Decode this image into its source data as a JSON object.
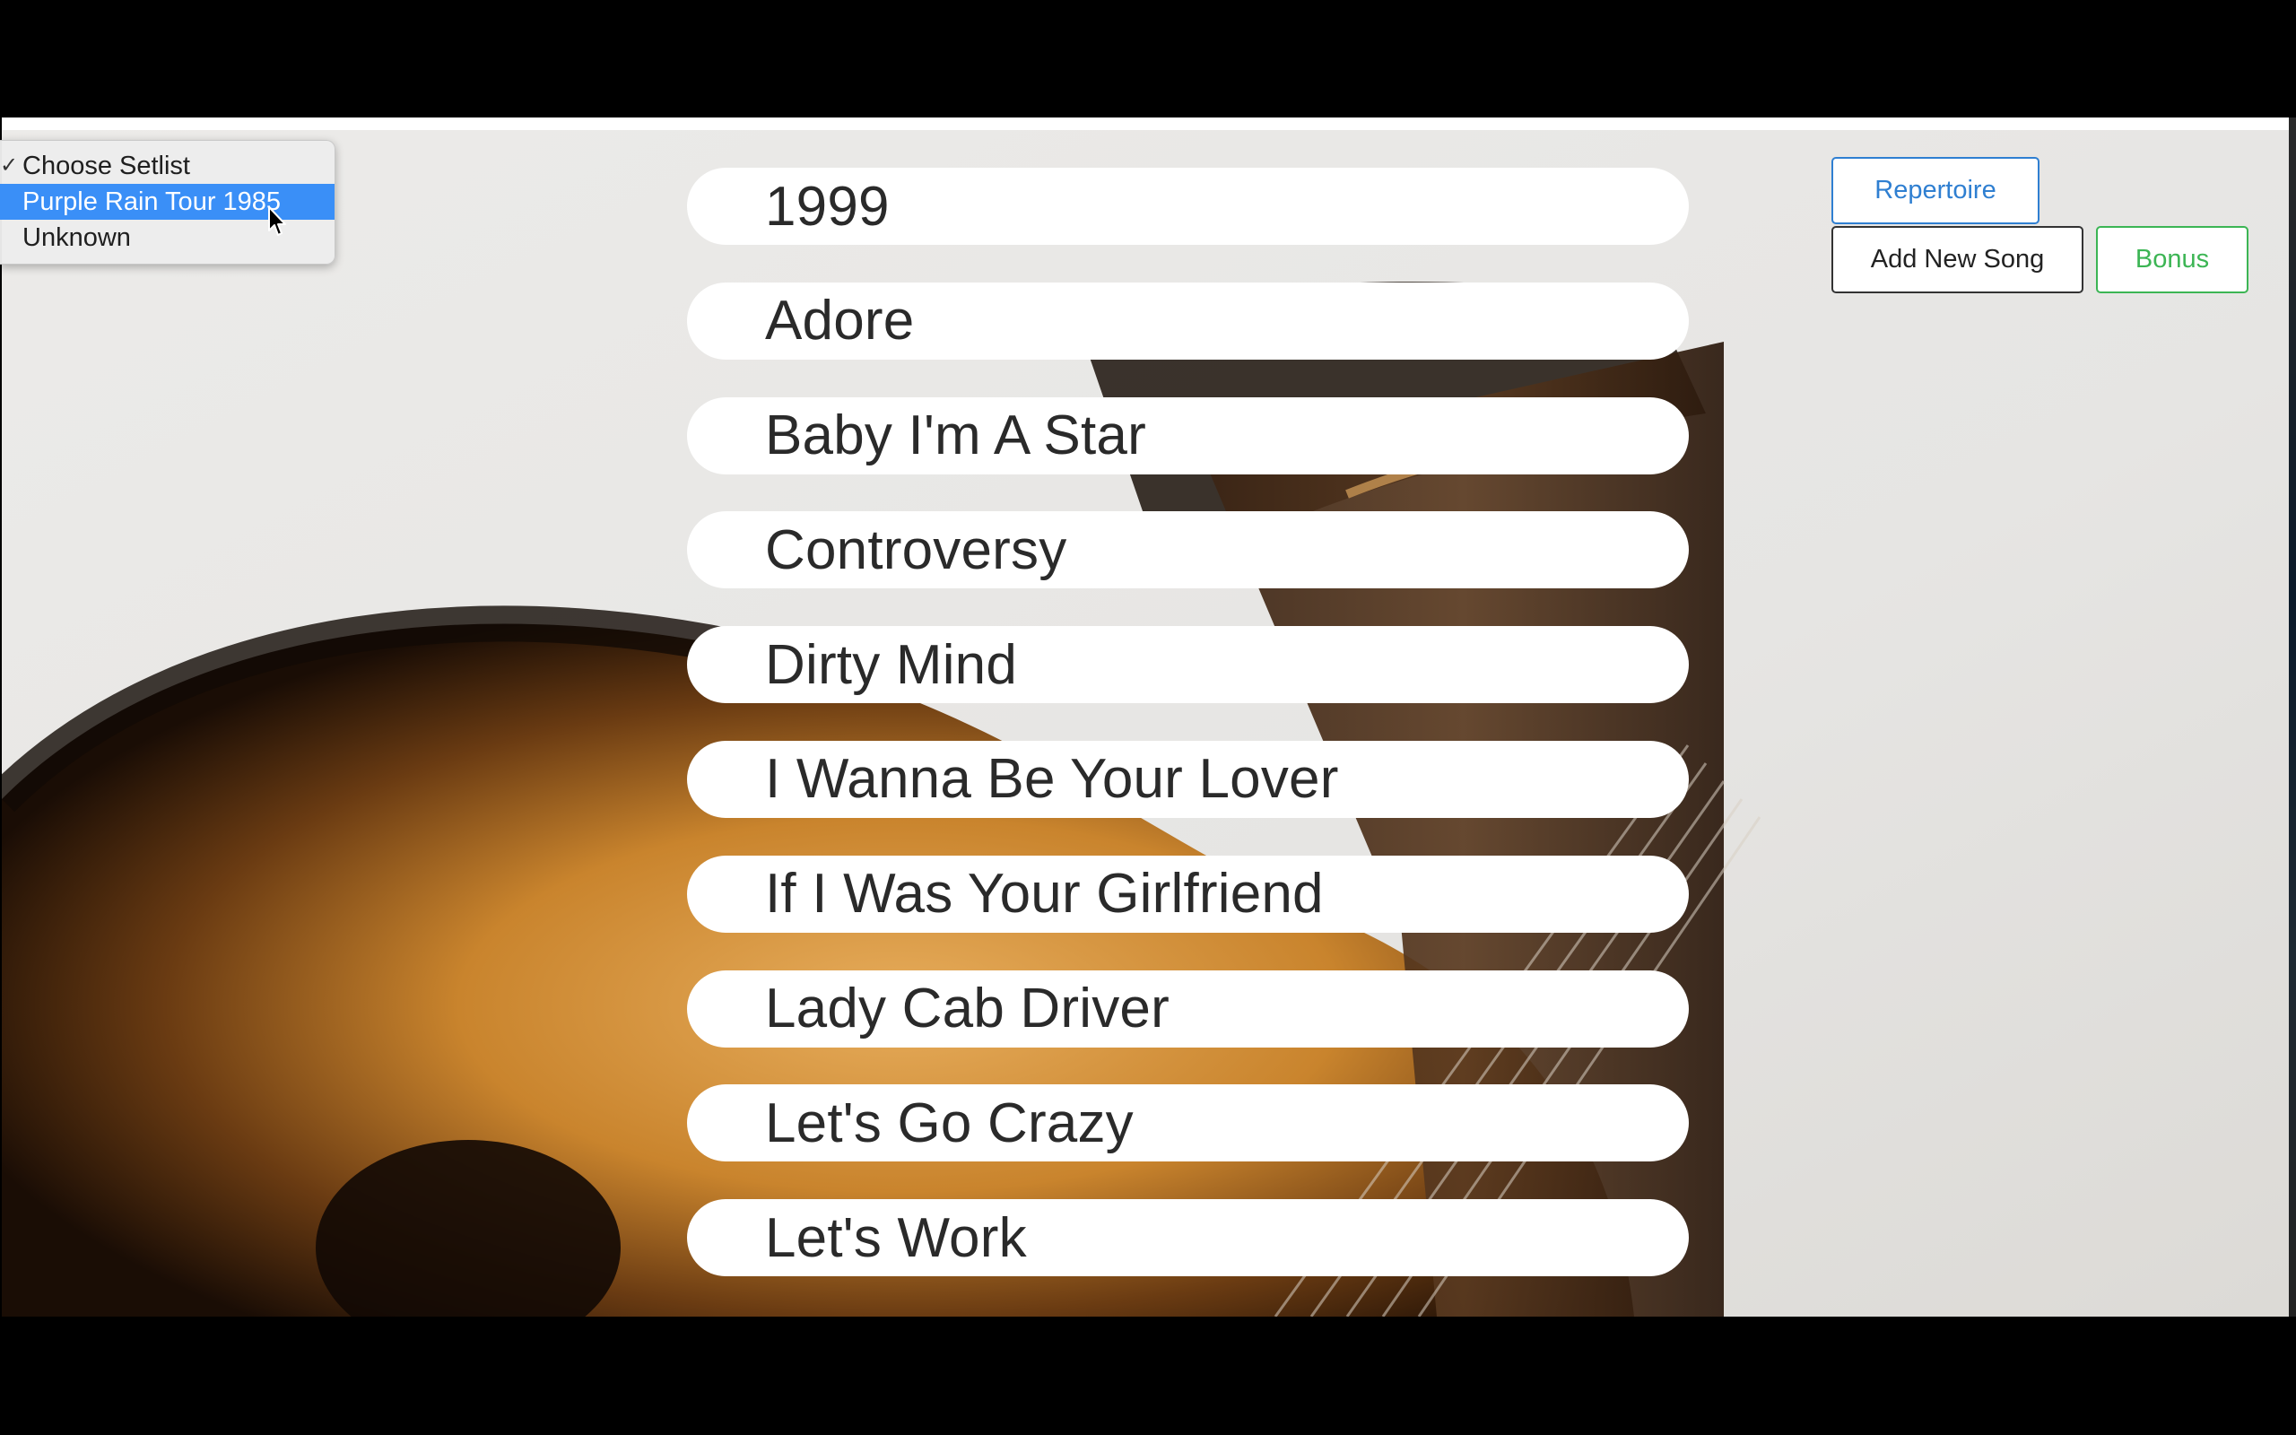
{
  "setlist_menu": {
    "options": [
      {
        "label": "Choose Setlist",
        "checked": true
      },
      {
        "label": "Purple Rain Tour 1985",
        "highlighted": true
      },
      {
        "label": "Unknown"
      }
    ],
    "check_glyph": "✓"
  },
  "songs": [
    "1999",
    "Adore",
    "Baby I'm A Star",
    "Controversy",
    "Dirty Mind",
    "I Wanna Be Your Lover",
    "If I Was Your Girlfriend",
    "Lady Cab Driver",
    "Let's Go Crazy",
    "Let's Work"
  ],
  "buttons": {
    "repertoire": "Repertoire",
    "add_new_song": "Add New Song",
    "bonus": "Bonus"
  },
  "colors": {
    "repertoire": "#2f7fd1",
    "bonus": "#3cb554",
    "selection": "#3a8ff7"
  },
  "background": {
    "subject": "acoustic-guitar-photo"
  }
}
